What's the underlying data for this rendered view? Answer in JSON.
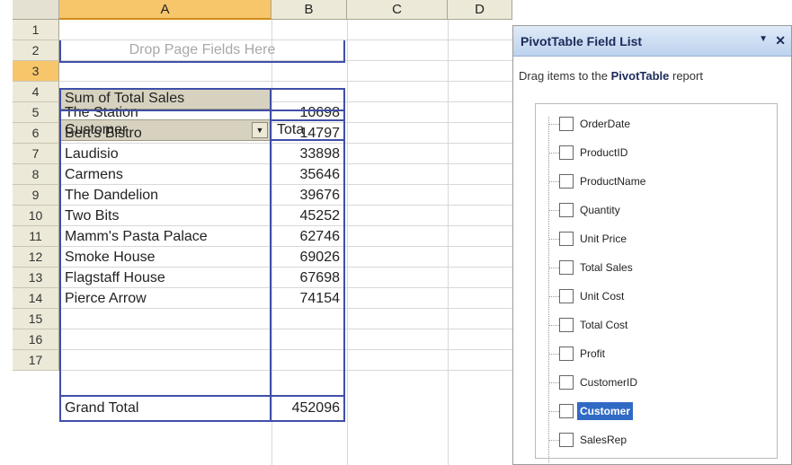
{
  "columns": [
    "A",
    "B",
    "C",
    "D"
  ],
  "rows": [
    "1",
    "2",
    "3",
    "4",
    "5",
    "6",
    "7",
    "8",
    "9",
    "10",
    "11",
    "12",
    "13",
    "14",
    "15",
    "16",
    "17"
  ],
  "pivot": {
    "page_fields_hint": "Drop Page Fields Here",
    "data_field": "Sum of Total Sales",
    "row_field": "Customer",
    "data_header": "Tota",
    "dropdown_icon": "dropdown-arrow-icon",
    "records": [
      {
        "customer": "The Station",
        "total": "10698"
      },
      {
        "customer": "Bert's Bistro",
        "total": "14797"
      },
      {
        "customer": "Laudisio",
        "total": "33898"
      },
      {
        "customer": "Carmens",
        "total": "35646"
      },
      {
        "customer": "The Dandelion",
        "total": "39676"
      },
      {
        "customer": "Two Bits",
        "total": "45252"
      },
      {
        "customer": "Mamm's Pasta Palace",
        "total": "62746"
      },
      {
        "customer": "Smoke House",
        "total": "69026"
      },
      {
        "customer": "Flagstaff House",
        "total": "67698"
      },
      {
        "customer": "Pierce Arrow",
        "total": "74154"
      }
    ],
    "grand_total_label": "Grand Total",
    "grand_total_value": "452096"
  },
  "panel": {
    "title": "PivotTable Field List",
    "menu_icon": "dropdown-arrow-icon",
    "close_icon": "close-icon",
    "instructions_prefix": "Drag items to the ",
    "instructions_bold": "PivotTable",
    "instructions_suffix": " report",
    "fields": [
      {
        "label": "OrderDate",
        "highlighted": false
      },
      {
        "label": "ProductID",
        "highlighted": false
      },
      {
        "label": "ProductName",
        "highlighted": false
      },
      {
        "label": "Quantity",
        "highlighted": false
      },
      {
        "label": "Unit Price",
        "highlighted": false
      },
      {
        "label": "Total Sales",
        "highlighted": false
      },
      {
        "label": "Unit Cost",
        "highlighted": false
      },
      {
        "label": "Total Cost",
        "highlighted": false
      },
      {
        "label": "Profit",
        "highlighted": false
      },
      {
        "label": "CustomerID",
        "highlighted": false
      },
      {
        "label": "Customer",
        "highlighted": true
      },
      {
        "label": "SalesRep",
        "highlighted": false
      }
    ]
  },
  "colors": {
    "pivot_border": "#3f4fa8",
    "header_selected": "#f7c66b",
    "field_highlight": "#316ac5"
  }
}
